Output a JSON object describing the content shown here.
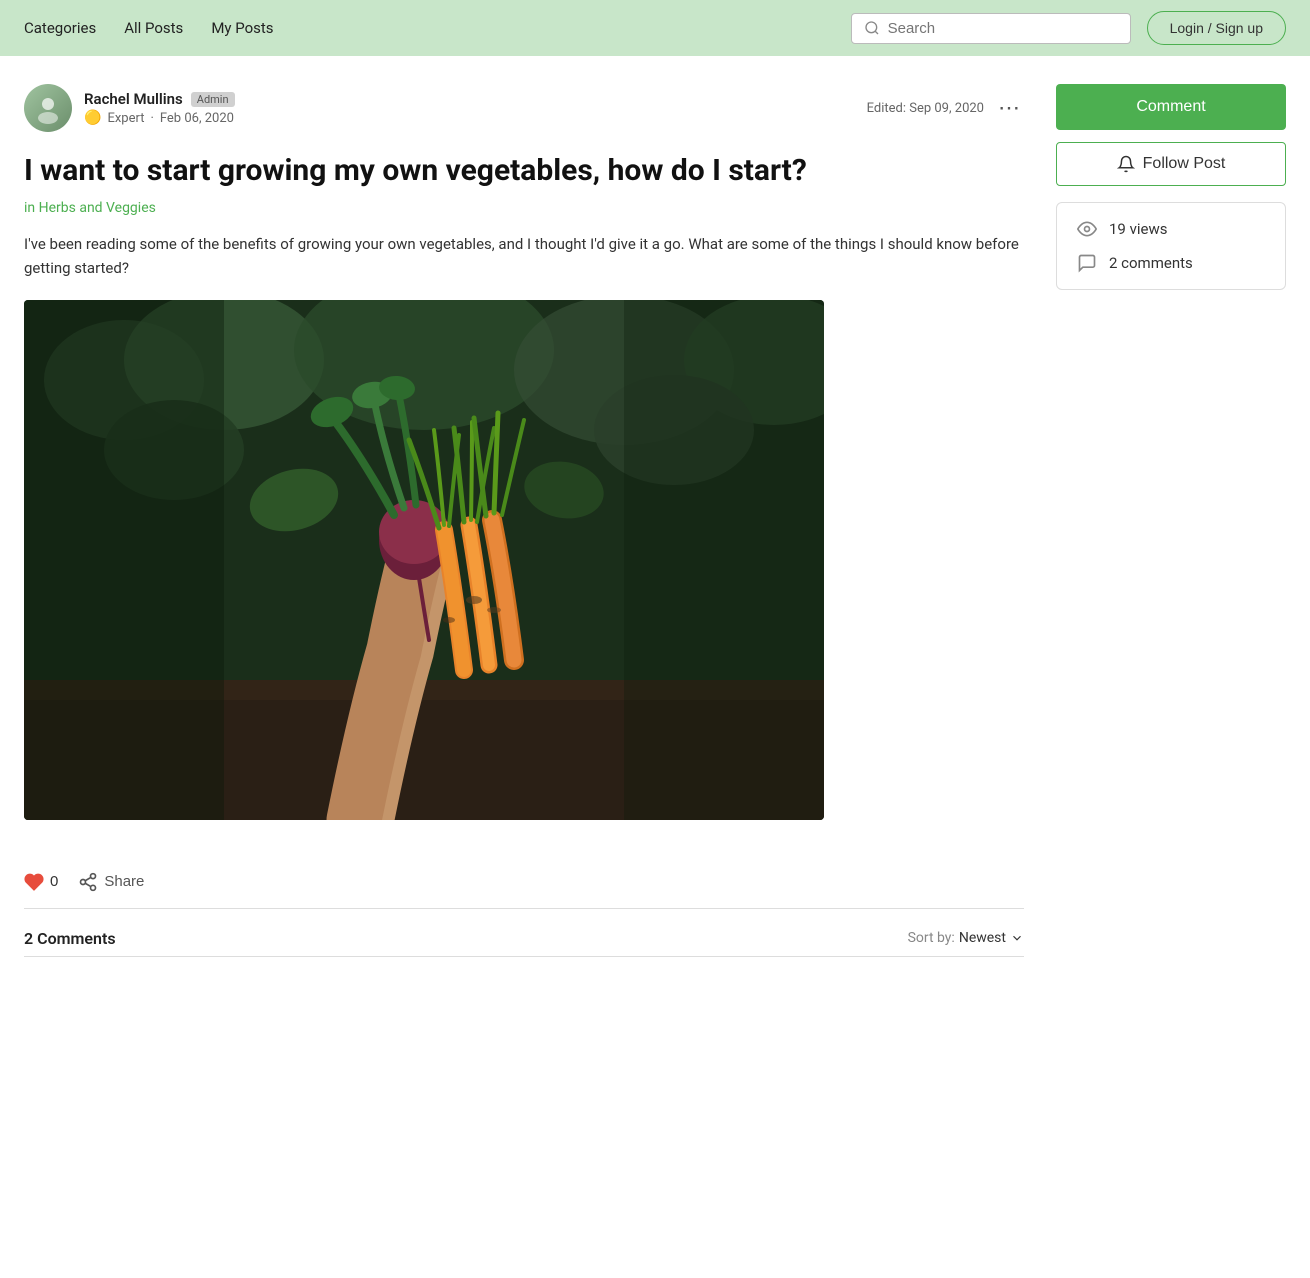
{
  "nav": {
    "categories_label": "Categories",
    "all_posts_label": "All Posts",
    "my_posts_label": "My Posts",
    "search_placeholder": "Search",
    "login_label": "Login / Sign up"
  },
  "post": {
    "author_name": "Rachel Mullins",
    "author_role": "Admin",
    "author_badge": "Expert",
    "post_date": "Feb 06, 2020",
    "edited_label": "Edited:",
    "edited_date": "Sep 09, 2020",
    "title": "I want to start growing my own vegetables, how do I start?",
    "category": "in Herbs and Veggies",
    "body": "I've been reading some of the benefits of growing your own vegetables, and I thought I'd give it a go. What are some of the things I should know before getting started?",
    "like_count": "0",
    "share_label": "Share",
    "comments_count_label": "2 Comments",
    "sort_label": "Sort by:",
    "sort_value": "Newest"
  },
  "sidebar": {
    "comment_label": "Comment",
    "follow_label": "Follow Post",
    "views_count": "19 views",
    "comments_count": "2 comments"
  }
}
